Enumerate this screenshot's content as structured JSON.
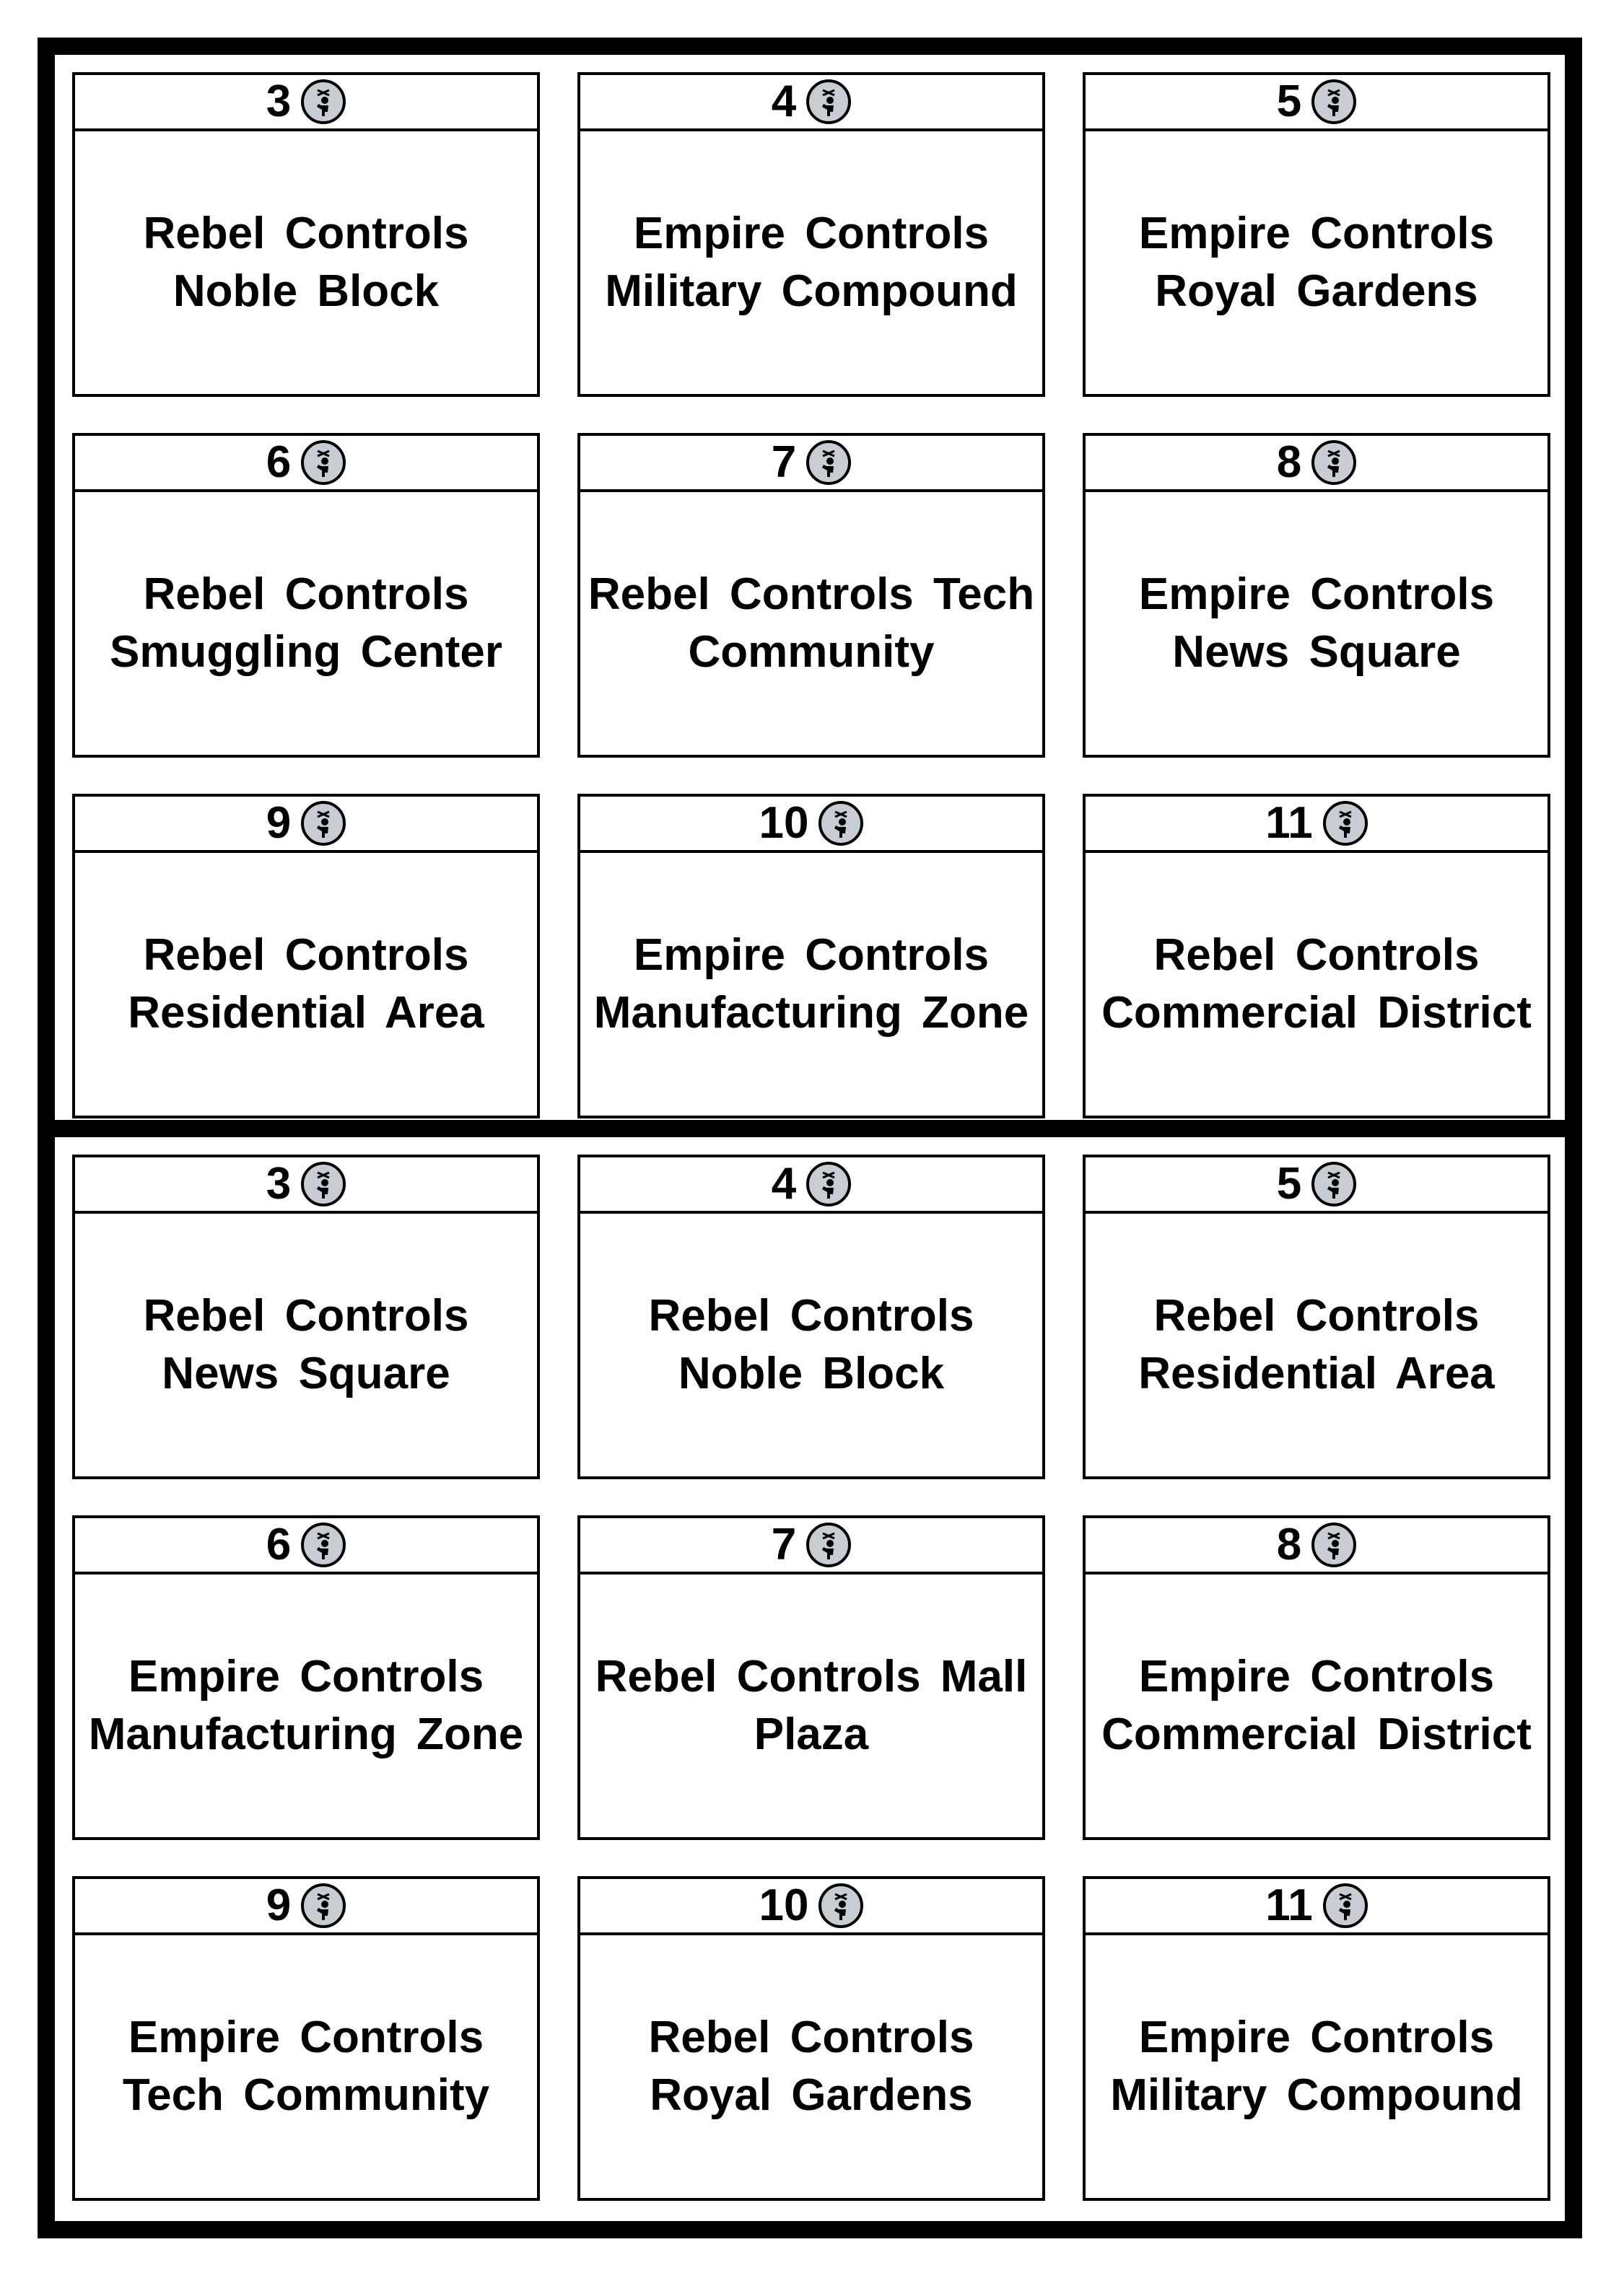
{
  "sheets": [
    {
      "cards": [
        {
          "number": "3",
          "text": "Rebel Controls Noble Block"
        },
        {
          "number": "4",
          "text": "Empire Controls Military Compound"
        },
        {
          "number": "5",
          "text": "Empire Controls Royal Gardens"
        },
        {
          "number": "6",
          "text": "Rebel Controls Smuggling Center"
        },
        {
          "number": "7",
          "text": "Rebel Controls Tech Community"
        },
        {
          "number": "8",
          "text": "Empire Controls News Square"
        },
        {
          "number": "9",
          "text": "Rebel Controls Residential Area"
        },
        {
          "number": "10",
          "text": "Empire Controls Manufacturing Zone"
        },
        {
          "number": "11",
          "text": "Rebel Controls Commercial District"
        }
      ]
    },
    {
      "cards": [
        {
          "number": "3",
          "text": "Rebel Controls News Square"
        },
        {
          "number": "4",
          "text": "Rebel Controls Noble Block"
        },
        {
          "number": "5",
          "text": "Rebel Controls Residential Area"
        },
        {
          "number": "6",
          "text": "Empire Controls Manufacturing Zone"
        },
        {
          "number": "7",
          "text": "Rebel Controls Mall Plaza"
        },
        {
          "number": "8",
          "text": "Empire Controls Commercial District"
        },
        {
          "number": "9",
          "text": "Empire Controls Tech Community"
        },
        {
          "number": "10",
          "text": "Rebel Controls Royal Gardens"
        },
        {
          "number": "11",
          "text": "Empire Controls Military Compound"
        }
      ]
    }
  ],
  "token_icon": "person-token-icon",
  "colors": {
    "ink": "#000000",
    "token_fill": "#c7cdd3",
    "paper": "#ffffff"
  }
}
